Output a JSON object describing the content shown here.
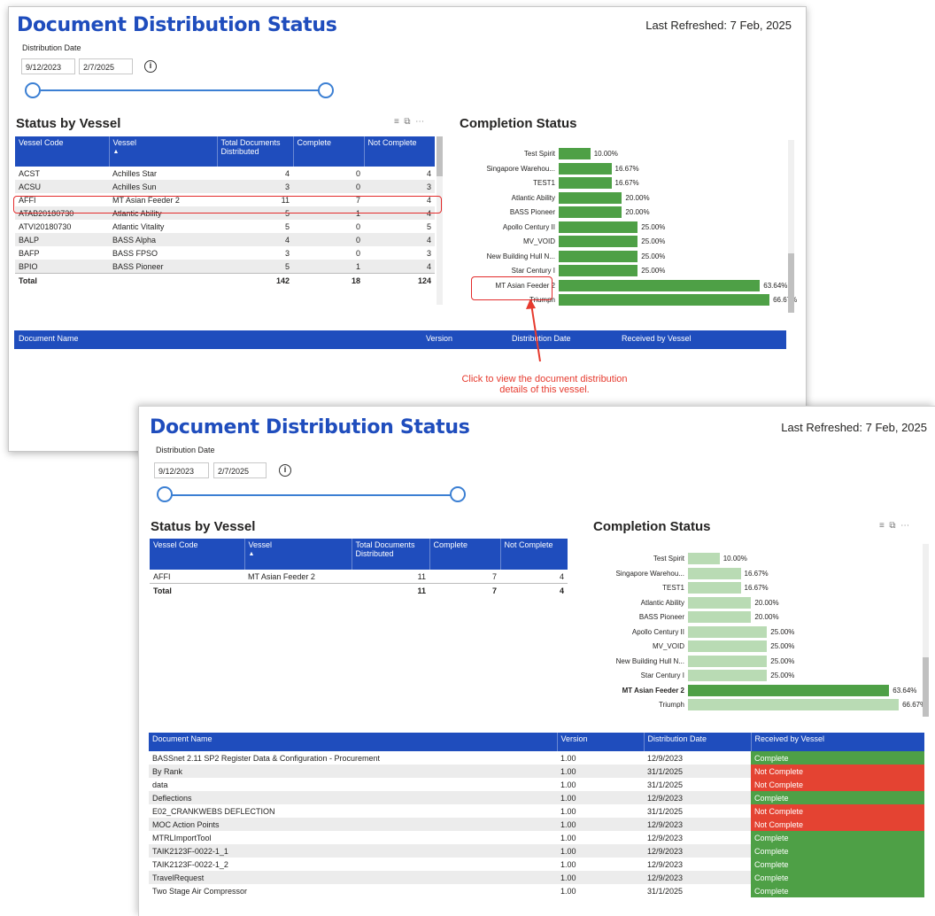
{
  "back": {
    "title": "Document Distribution Status",
    "last_refreshed": "Last Refreshed: 7 Feb, 2025",
    "date_label": "Distribution Date",
    "date_from": "9/12/2023",
    "date_to": "2/7/2025",
    "info_icon": "info-icon",
    "status_title": "Status by Vessel",
    "table_headers": [
      "Vessel Code",
      "Vessel",
      "Total Documents Distributed",
      "Complete",
      "Not Complete"
    ],
    "rows": [
      [
        "ACST",
        "Achilles Star",
        "4",
        "0",
        "4"
      ],
      [
        "ACSU",
        "Achilles Sun",
        "3",
        "0",
        "3"
      ],
      [
        "AFFI",
        "MT Asian Feeder 2",
        "11",
        "7",
        "4"
      ],
      [
        "ATAB20180730",
        "Atlantic Ability",
        "5",
        "1",
        "4"
      ],
      [
        "ATVI20180730",
        "Atlantic Vitality",
        "5",
        "0",
        "5"
      ],
      [
        "BALP",
        "BASS Alpha",
        "4",
        "0",
        "4"
      ],
      [
        "BAFP",
        "BASS FPSO",
        "3",
        "0",
        "3"
      ],
      [
        "BPIO",
        "BASS Pioneer",
        "5",
        "1",
        "4"
      ]
    ],
    "total": [
      "Total",
      "",
      "142",
      "18",
      "124"
    ],
    "completion_title": "Completion Status",
    "doc_headers": [
      "Document Name",
      "Version",
      "Distribution Date",
      "Received by Vessel"
    ],
    "annotation_line1": "Click to view the document distribution",
    "annotation_line2": "details of this vessel."
  },
  "front": {
    "title": "Document Distribution Status",
    "last_refreshed": "Last Refreshed: 7 Feb, 2025",
    "date_label": "Distribution Date",
    "date_from": "9/12/2023",
    "date_to": "2/7/2025",
    "status_title": "Status by Vessel",
    "table_headers": [
      "Vessel Code",
      "Vessel",
      "Total Documents Distributed",
      "Complete",
      "Not Complete"
    ],
    "rows": [
      [
        "AFFI",
        "MT Asian Feeder 2",
        "11",
        "7",
        "4"
      ]
    ],
    "total": [
      "Total",
      "",
      "11",
      "7",
      "4"
    ],
    "completion_title": "Completion Status",
    "doc_headers": [
      "Document Name",
      "Version",
      "Distribution Date",
      "Received by Vessel"
    ],
    "docs": [
      [
        "BASSnet 2.11 SP2 Register Data & Configuration - Procurement",
        "1.00",
        "12/9/2023",
        "Complete"
      ],
      [
        "By Rank",
        "1.00",
        "31/1/2025",
        "Not Complete"
      ],
      [
        "data",
        "1.00",
        "31/1/2025",
        "Not Complete"
      ],
      [
        "Deflections",
        "1.00",
        "12/9/2023",
        "Complete"
      ],
      [
        "E02_CRANKWEBS DEFLECTION",
        "1.00",
        "31/1/2025",
        "Not Complete"
      ],
      [
        "MOC Action Points",
        "1.00",
        "12/9/2023",
        "Not Complete"
      ],
      [
        "MTRLImportTool",
        "1.00",
        "12/9/2023",
        "Complete"
      ],
      [
        "TAIK2123F-0022-1_1",
        "1.00",
        "12/9/2023",
        "Complete"
      ],
      [
        "TAIK2123F-0022-1_2",
        "1.00",
        "12/9/2023",
        "Complete"
      ],
      [
        "TravelRequest",
        "1.00",
        "12/9/2023",
        "Complete"
      ],
      [
        "Two Stage Air Compressor",
        "1.00",
        "31/1/2025",
        "Complete"
      ]
    ]
  },
  "colors": {
    "accent": "#1f4dbd",
    "bar": "#4ea046",
    "bar_faded": "#b9dbb4",
    "complete": "#4ea046",
    "not_complete": "#e44332",
    "annotation": "#e63a2e"
  },
  "chart_data": [
    {
      "type": "bar",
      "orientation": "horizontal",
      "title": "Completion Status",
      "categories": [
        "Test Spirit",
        "Singapore Warehou...",
        "TEST1",
        "Atlantic Ability",
        "BASS Pioneer",
        "Apollo Century II",
        "MV_VOID",
        "New Building Hull N...",
        "Star Century I",
        "MT Asian Feeder 2",
        "Triumph"
      ],
      "values": [
        10.0,
        16.67,
        16.67,
        20.0,
        20.0,
        25.0,
        25.0,
        25.0,
        25.0,
        63.64,
        66.67
      ],
      "value_labels": [
        "10.00%",
        "16.67%",
        "16.67%",
        "20.00%",
        "20.00%",
        "25.00%",
        "25.00%",
        "25.00%",
        "25.00%",
        "63.64%",
        "66.67%"
      ],
      "highlight": null
    },
    {
      "type": "bar",
      "orientation": "horizontal",
      "title": "Completion Status",
      "categories": [
        "Test Spirit",
        "Singapore Warehou...",
        "TEST1",
        "Atlantic Ability",
        "BASS Pioneer",
        "Apollo Century II",
        "MV_VOID",
        "New Building Hull N...",
        "Star Century I",
        "MT Asian Feeder 2",
        "Triumph"
      ],
      "values": [
        10.0,
        16.67,
        16.67,
        20.0,
        20.0,
        25.0,
        25.0,
        25.0,
        25.0,
        63.64,
        66.67
      ],
      "value_labels": [
        "10.00%",
        "16.67%",
        "16.67%",
        "20.00%",
        "20.00%",
        "25.00%",
        "25.00%",
        "25.00%",
        "25.00%",
        "63.64%",
        "66.67%"
      ],
      "highlight": "MT Asian Feeder 2"
    }
  ]
}
